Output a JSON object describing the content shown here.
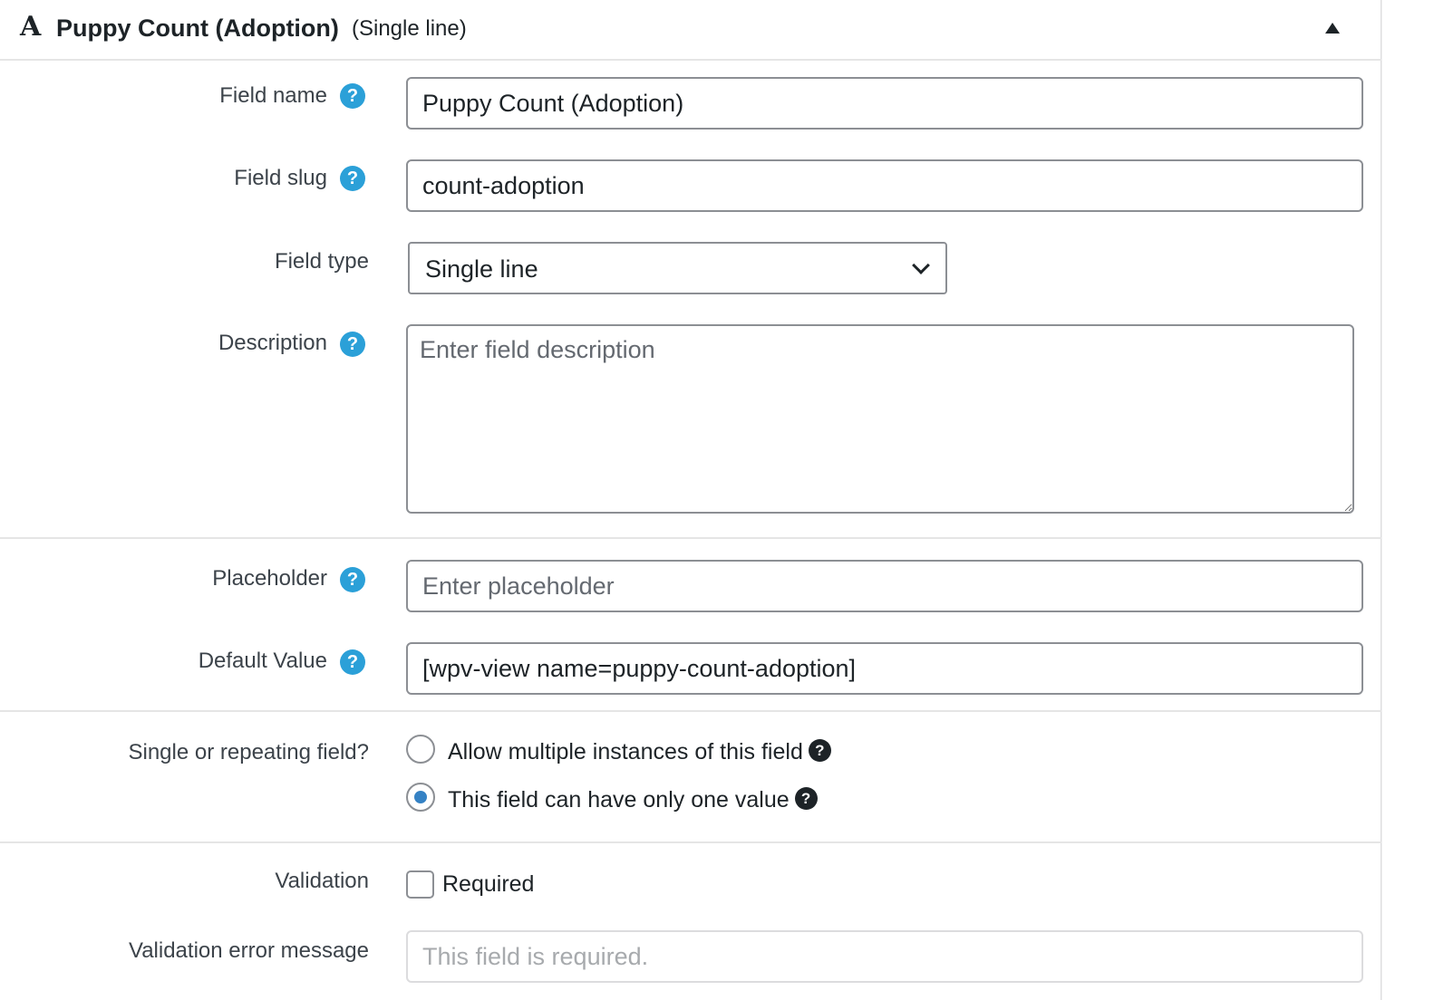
{
  "header": {
    "type_icon": "A",
    "title": "Puppy Count (Adoption)",
    "type_label": "(Single line)"
  },
  "fields": {
    "name": {
      "label": "Field name",
      "value": "Puppy Count (Adoption)"
    },
    "slug": {
      "label": "Field slug",
      "value": "count-adoption"
    },
    "type": {
      "label": "Field type",
      "value": "Single line"
    },
    "description": {
      "label": "Description",
      "placeholder": "Enter field description"
    },
    "placeholder": {
      "label": "Placeholder",
      "placeholder": "Enter placeholder"
    },
    "default_value": {
      "label": "Default Value",
      "value": "[wpv-view name=puppy-count-adoption]"
    },
    "repeating": {
      "label": "Single or repeating field?",
      "options": [
        {
          "label": "Allow multiple instances of this field",
          "checked": false
        },
        {
          "label": "This field can have only one value",
          "checked": true
        }
      ]
    },
    "validation": {
      "label": "Validation",
      "required_label": "Required",
      "required": false
    },
    "validation_error": {
      "label": "Validation error message",
      "placeholder": "This field is required."
    }
  },
  "help_glyph": "?",
  "colors": {
    "help_icon": "#2ba0d8",
    "radio_checked": "#3582c4",
    "border": "#8c8f94"
  }
}
